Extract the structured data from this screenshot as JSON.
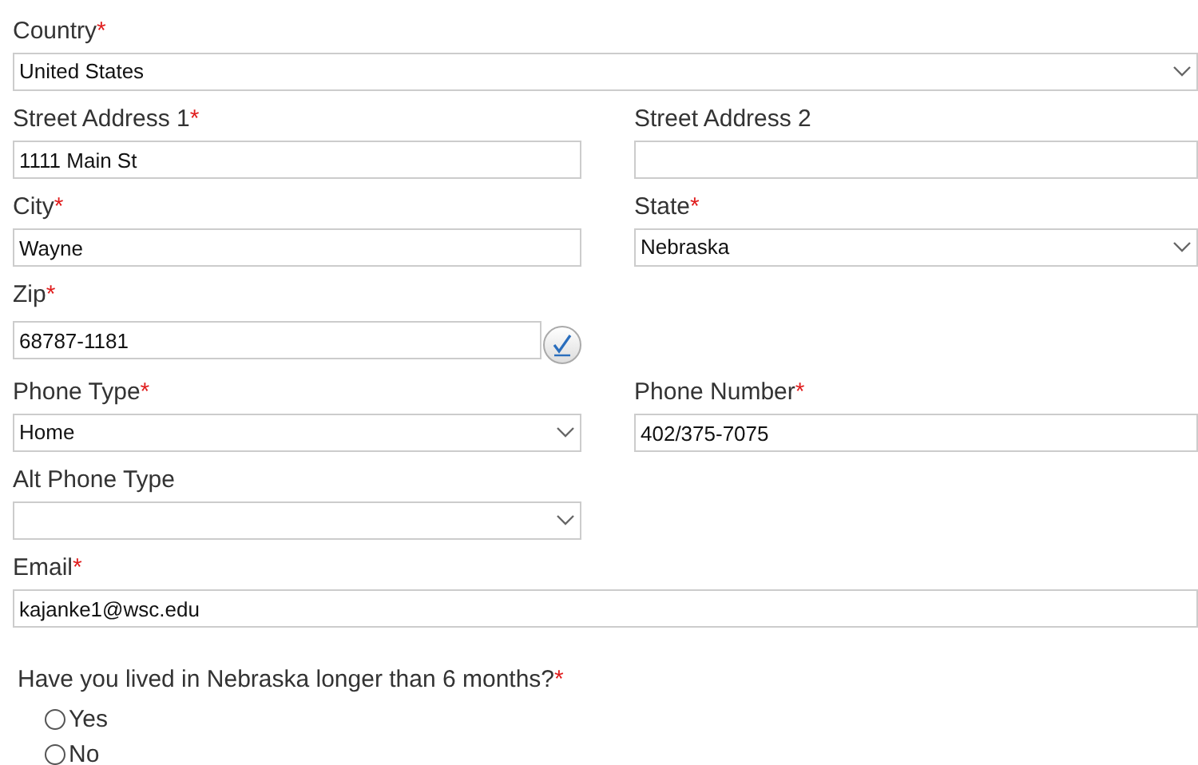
{
  "rows": [
    {
      "fields": [
        {
          "label": "Country",
          "mark": "*",
          "kind": "select",
          "wide": true,
          "value": "United States"
        }
      ]
    },
    {
      "fields": [
        {
          "label": "Street Address 1",
          "mark": "*",
          "kind": "text",
          "wide": false,
          "value": "1111 Main St"
        },
        {
          "label": "Street Address 2",
          "kind": "text",
          "wide": false
        }
      ]
    },
    {
      "fields": [
        {
          "label": "City",
          "mark": "*",
          "kind": "text",
          "wide": false,
          "value": "Wayne"
        },
        {
          "label": "State",
          "mark": "*",
          "kind": "select",
          "wide": false,
          "value": "Nebraska"
        }
      ]
    },
    {
      "fields": [
        {
          "label": "Zip",
          "mark": "*",
          "kind": "verify",
          "wide": false,
          "value": "68787-1181"
        }
      ]
    },
    {
      "fields": [
        {
          "label": "Phone Type",
          "mark": "*",
          "kind": "select",
          "wide": false,
          "value": "Home"
        },
        {
          "label": "Phone Number",
          "mark": "*",
          "kind": "text",
          "wide": false,
          "value": "402/375-7075"
        }
      ]
    },
    {
      "fields": [
        {
          "label": "Alt Phone Type",
          "kind": "select",
          "wide": false
        }
      ]
    },
    {
      "fields": [
        {
          "label": "Email",
          "mark": "*",
          "kind": "text",
          "wide": true,
          "value": "kajanke1@wsc.edu"
        }
      ]
    }
  ],
  "question": {
    "text": "Have you lived in Nebraska longer than 6 months?",
    "mark": "*",
    "options": [
      {
        "label": "Yes",
        "selected": false
      },
      {
        "label": "No",
        "selected": false
      }
    ]
  }
}
